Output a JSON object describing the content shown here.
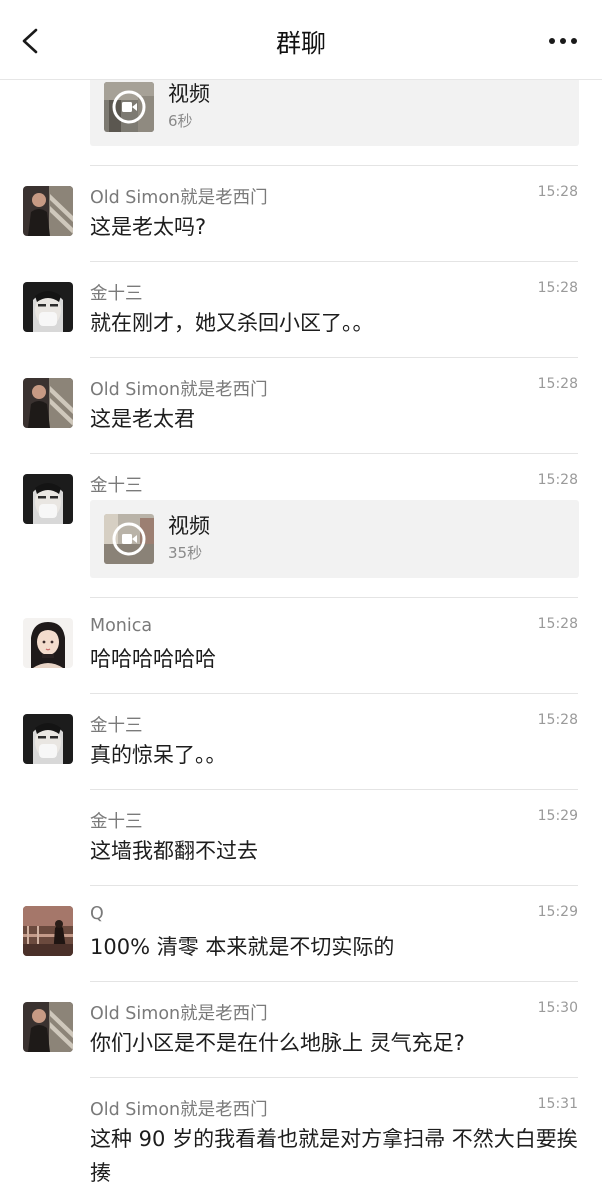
{
  "header": {
    "title": "群聊",
    "back_icon": "chevron-left-icon",
    "more_icon": "more-horizontal-icon"
  },
  "video_label": "视频",
  "top_video": {
    "duration": "6秒"
  },
  "messages": [
    {
      "sender": "Old Simon就是老西门",
      "time": "15:28",
      "text": "这是老太吗?"
    },
    {
      "sender": "金十三",
      "time": "15:28",
      "text": "就在刚才，她又杀回小区了。。"
    },
    {
      "sender": "Old Simon就是老西门",
      "time": "15:28",
      "text": "这是老太君"
    },
    {
      "sender": "金十三",
      "time": "15:28",
      "video_duration": "35秒"
    },
    {
      "sender": "Monica",
      "time": "15:28",
      "text": "哈哈哈哈哈哈"
    },
    {
      "sender": "金十三",
      "time": "15:28",
      "text": "真的惊呆了。。"
    },
    {
      "sender": "金十三",
      "time": "15:29",
      "text": "这墙我都翻不过去"
    },
    {
      "sender": "Q",
      "time": "15:29",
      "text": "100% 清零 本来就是不切实际的"
    },
    {
      "sender": "Old Simon就是老西门",
      "time": "15:30",
      "text": "你们小区是不是在什么地脉上 灵气充足?"
    },
    {
      "sender": "Old Simon就是老西门",
      "time": "15:31",
      "text": "这种 90 岁的我看着也就是对方拿扫帚 不然大白要挨揍"
    }
  ]
}
